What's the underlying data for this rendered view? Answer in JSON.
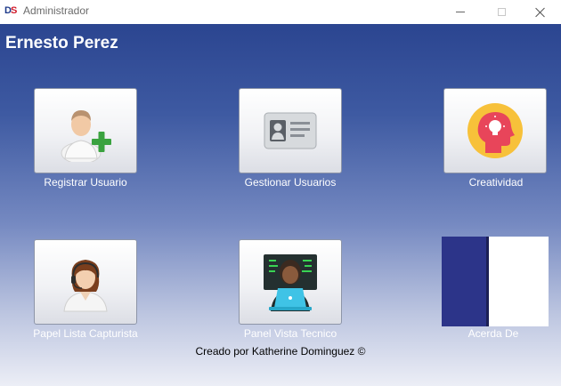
{
  "window": {
    "title": "Administrador",
    "logo_d": "D",
    "logo_s": "S"
  },
  "header": {
    "user_name": "Ernesto Perez"
  },
  "modules": {
    "registrar": {
      "label": "Registrar Usuario",
      "icon": "add-user-icon"
    },
    "gestionar": {
      "label": "Gestionar Usuarios",
      "icon": "id-card-icon"
    },
    "creatividad": {
      "label": "Creatividad",
      "icon": "creativity-head-icon"
    },
    "capturista": {
      "label": "Papel Lista Capturista",
      "icon": "headset-operator-icon"
    },
    "tecnico": {
      "label": "Panel Vista Tecnico",
      "icon": "technician-laptop-icon"
    },
    "acerca": {
      "label": "Acerda De"
    }
  },
  "footer": {
    "credits": "Creado por Katherine Dominguez ©"
  },
  "colors": {
    "gradient_top": "#2b4590",
    "gradient_bottom": "#eceef6",
    "about_dark": "#2c3489"
  }
}
